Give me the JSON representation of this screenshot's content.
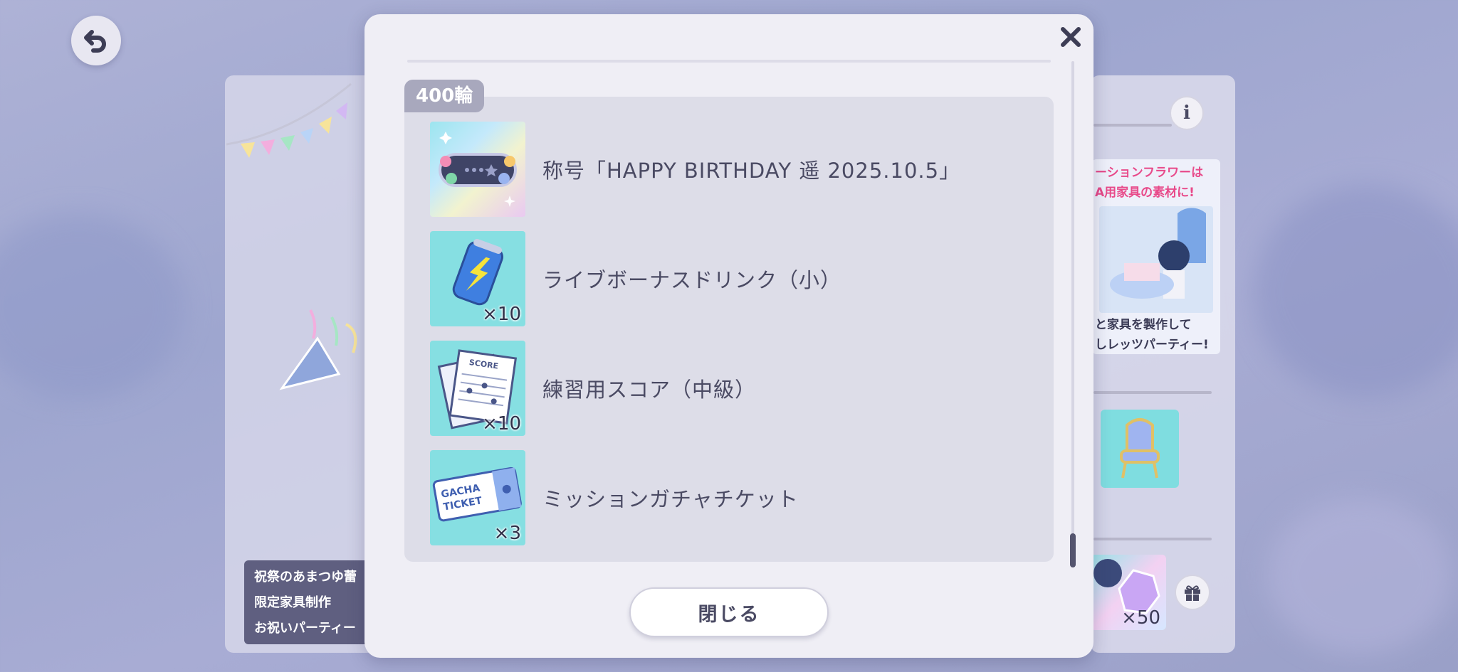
{
  "background": {
    "left_note": [
      "祝祭のあまつゆ蕾",
      "限定家具制作",
      "お祝いパーティー"
    ],
    "ad_lines": [
      {
        "text": "ーションフラワーは",
        "color": "#e84a8a"
      },
      {
        "text": "A用家具の素材に!",
        "color": "#e84a8a"
      },
      {
        "text": "と家具を製作して",
        "color": "#3a3a55"
      },
      {
        "text": "しレッツパーティー!",
        "color": "#3a3a55"
      }
    ],
    "gem_count": "×50"
  },
  "modal": {
    "tier_label": "400輪",
    "rewards": [
      {
        "name": "称号「HAPPY BIRTHDAY 遥 2025.10.5」",
        "quantity": "",
        "icon": "title-badge-icon"
      },
      {
        "name": "ライブボーナスドリンク（小）",
        "quantity": "×10",
        "icon": "energy-drink-icon"
      },
      {
        "name": "練習用スコア（中級）",
        "quantity": "×10",
        "icon": "practice-score-icon"
      },
      {
        "name": "ミッションガチャチケット",
        "quantity": "×3",
        "icon": "gacha-ticket-icon"
      }
    ],
    "close_button_label": "閉じる"
  },
  "colors": {
    "accent_pink": "#e84a8a",
    "modal_bg": "#efeef5",
    "tile_cyan": "#86dfe2"
  }
}
